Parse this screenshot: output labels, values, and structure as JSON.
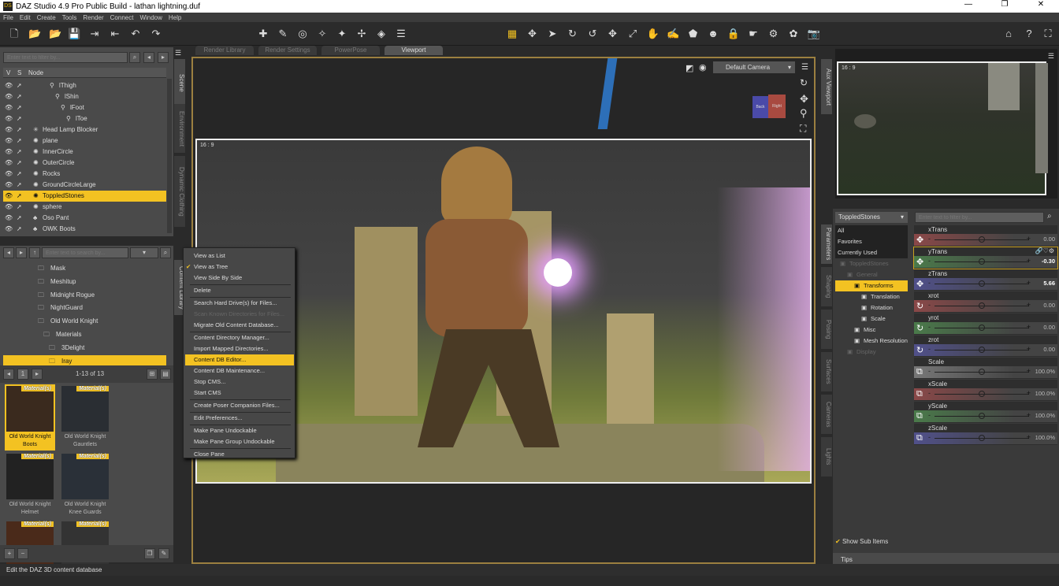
{
  "app": {
    "title": "DAZ Studio 4.9 Pro Public Build - lathan lightning.duf",
    "logo": "DS"
  },
  "menu": [
    "File",
    "Edit",
    "Create",
    "Tools",
    "Render",
    "Connect",
    "Window",
    "Help"
  ],
  "scene": {
    "filter_placeholder": "Enter text to filter by...",
    "col_v": "V",
    "col_s": "S",
    "col_node": "Node",
    "nodes": [
      {
        "label": "lThigh",
        "indent": 3,
        "icon": "bone"
      },
      {
        "label": "lShin",
        "indent": 4,
        "icon": "bone"
      },
      {
        "label": "lFoot",
        "indent": 5,
        "icon": "bone"
      },
      {
        "label": "lToe",
        "indent": 6,
        "icon": "bone"
      },
      {
        "label": "Head Lamp Blocker",
        "indent": 0,
        "icon": "light"
      },
      {
        "label": "plane",
        "indent": 0,
        "icon": "prop"
      },
      {
        "label": "InnerCircle",
        "indent": 0,
        "icon": "prop"
      },
      {
        "label": "OuterCircle",
        "indent": 0,
        "icon": "prop"
      },
      {
        "label": "Rocks",
        "indent": 0,
        "icon": "prop"
      },
      {
        "label": "GroundCircleLarge",
        "indent": 0,
        "icon": "prop"
      },
      {
        "label": "ToppledStones",
        "indent": 0,
        "icon": "prop",
        "selected": true
      },
      {
        "label": "sphere",
        "indent": 0,
        "icon": "prop"
      },
      {
        "label": "Oso Pant",
        "indent": 0,
        "icon": "figure"
      },
      {
        "label": "OWK Boots",
        "indent": 0,
        "icon": "figure"
      }
    ]
  },
  "left_tabs": [
    "Scene",
    "Environment",
    "Dynamic Clothing",
    "Content Library"
  ],
  "content": {
    "search_placeholder": "Enter text to search by...",
    "folders": [
      {
        "label": "Mask",
        "indent": 1
      },
      {
        "label": "Meshitup",
        "indent": 1
      },
      {
        "label": "Midnight Rogue",
        "indent": 1
      },
      {
        "label": "NightGuard",
        "indent": 1
      },
      {
        "label": "Old World Knight",
        "indent": 1
      },
      {
        "label": "Materials",
        "indent": 2
      },
      {
        "label": "3Delight",
        "indent": 3
      },
      {
        "label": "Iray",
        "indent": 3,
        "selected": true
      }
    ],
    "page": "1",
    "range": "1-13 of 13",
    "badge": "Material(s)",
    "items": [
      {
        "label": "Old World Knight Boots",
        "selected": true
      },
      {
        "label": "Old World Knight Gauntlets"
      },
      {
        "label": "Old World Knight Helmet"
      },
      {
        "label": "Old World Knight Knee Guards"
      },
      {
        "label": ""
      },
      {
        "label": ""
      }
    ]
  },
  "context_menu": [
    {
      "label": "View as List"
    },
    {
      "label": "View as Tree",
      "checked": true
    },
    {
      "label": "View Side By Side"
    },
    {
      "sep": true
    },
    {
      "label": "Delete"
    },
    {
      "sep": true
    },
    {
      "label": "Search Hard Drive(s) for Files..."
    },
    {
      "label": "Scan Known Directories for Files...",
      "disabled": true
    },
    {
      "label": "Migrate Old Content Database..."
    },
    {
      "sep": true
    },
    {
      "label": "Content Directory Manager..."
    },
    {
      "label": "Import Mapped Directories..."
    },
    {
      "label": "Content DB Editor...",
      "highlighted": true
    },
    {
      "label": "Content DB Maintenance..."
    },
    {
      "label": "Stop CMS..."
    },
    {
      "label": "Start CMS"
    },
    {
      "sep": true
    },
    {
      "label": "Create Poser Companion Files..."
    },
    {
      "sep": true
    },
    {
      "label": "Edit Preferences..."
    },
    {
      "sep": true
    },
    {
      "label": "Make Pane Undockable"
    },
    {
      "label": "Make Pane Group Undockable"
    },
    {
      "sep": true
    },
    {
      "label": "Close Pane"
    }
  ],
  "viewport": {
    "tabs": [
      "Render Library",
      "Render Settings",
      "PowerPose",
      "Viewport"
    ],
    "active_tab": "Viewport",
    "camera": "Default Camera",
    "aspect": "16 : 9",
    "cube_left": "Back",
    "cube_right": "Right"
  },
  "aux": {
    "tab": "Aux Viewport",
    "aspect": "16 : 9"
  },
  "right_tabs": [
    "Parameters",
    "Shaping",
    "Posing",
    "Surfaces",
    "Cameras",
    "Lights"
  ],
  "params": {
    "node": "ToppledStones",
    "filter_placeholder": "Enter text to filter by...",
    "tree": [
      {
        "label": "All",
        "kind": "flat"
      },
      {
        "label": "Favorites",
        "kind": "flat"
      },
      {
        "label": "Currently Used",
        "kind": "flat"
      },
      {
        "label": "ToppledStones",
        "indent": 0,
        "dim": true
      },
      {
        "label": "General",
        "indent": 1,
        "dim": true
      },
      {
        "label": "Transforms",
        "indent": 2,
        "selected": true
      },
      {
        "label": "Translation",
        "indent": 3
      },
      {
        "label": "Rotation",
        "indent": 3
      },
      {
        "label": "Scale",
        "indent": 3
      },
      {
        "label": "Misc",
        "indent": 2
      },
      {
        "label": "Mesh Resolution",
        "indent": 2
      },
      {
        "label": "Display",
        "indent": 1,
        "dim": true
      }
    ],
    "sliders": [
      {
        "name": "xTrans",
        "value": "0.00",
        "axis": "x",
        "icon": "move",
        "fraction": 0.5
      },
      {
        "name": "yTrans",
        "value": "-0.30",
        "axis": "y",
        "icon": "move",
        "fraction": 0.5,
        "active": true
      },
      {
        "name": "zTrans",
        "value": "5.66",
        "axis": "z",
        "icon": "move",
        "fraction": 0.5
      },
      {
        "name": "xrot",
        "value": "0.00",
        "axis": "x",
        "icon": "rotate",
        "fraction": 0.5
      },
      {
        "name": "yrot",
        "value": "0.00",
        "axis": "y",
        "icon": "rotate",
        "fraction": 0.5
      },
      {
        "name": "zrot",
        "value": "0.00",
        "axis": "z",
        "icon": "rotate",
        "fraction": 0.5
      },
      {
        "name": "Scale",
        "value": "100.0%",
        "axis": "u",
        "icon": "scale",
        "fraction": 0.5
      },
      {
        "name": "xScale",
        "value": "100.0%",
        "axis": "x",
        "icon": "scale",
        "fraction": 0.5
      },
      {
        "name": "yScale",
        "value": "100.0%",
        "axis": "y",
        "icon": "scale",
        "fraction": 0.5
      },
      {
        "name": "zScale",
        "value": "100.0%",
        "axis": "z",
        "icon": "scale",
        "fraction": 0.5
      }
    ],
    "show_sub_items": "Show Sub Items",
    "tips": "Tips"
  },
  "status": "Edit the DAZ 3D content database",
  "colors": {
    "accent": "#f3c222",
    "x": "#8a4848",
    "y": "#4a7a4a",
    "z": "#50508a",
    "u": "#777777"
  }
}
